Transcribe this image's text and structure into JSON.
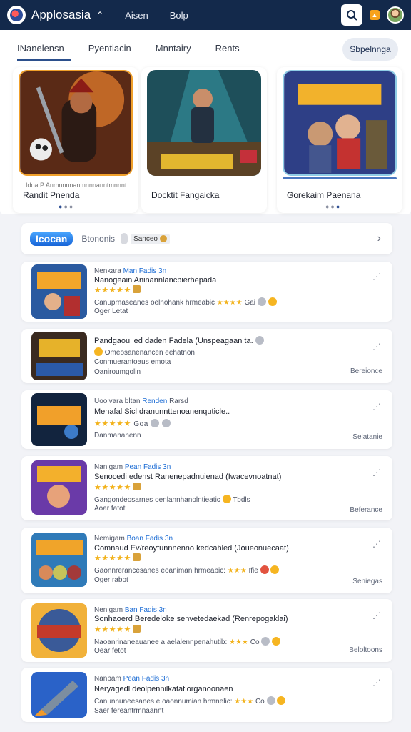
{
  "header": {
    "title": "Applosasia",
    "caret": "^",
    "nav": [
      "Aisen",
      "Bolp"
    ]
  },
  "tabs": [
    "INanelensn",
    "Pyentiacin",
    "Mnntairy",
    "Rents"
  ],
  "see_all": "Sbpelnnga",
  "featured": [
    {
      "sub": "Idoa P Anmnnnnanmnnnanntmnnnt",
      "name": "Randit Pnenda"
    },
    {
      "sub": "",
      "name": "Docktit Fangaicka"
    },
    {
      "sub": "",
      "name": "Gorekaim Paenana"
    }
  ],
  "filter": {
    "brand": "Icocan",
    "label": "Btononis",
    "tag": "Sanceo"
  },
  "list": [
    {
      "t1a": "Nenkara ",
      "t1b": "Man Fadis 3n",
      "t2": "Nanogeain Aninannlancpierhepada",
      "t3": "★★★★★",
      "t4": "Canuprnaseanes oelnohank hrmeabic",
      "t4b": "Gai",
      "t5": "Oger Letat",
      "side": ""
    },
    {
      "t1a": "",
      "t1b": "",
      "t2": "Pandgaou led daden Fadela (Unspeagaan ta.",
      "t3": "Omeosanenancen eehatnon",
      "t4": "Conmuerantoaus emota",
      "t4b": "",
      "t5": "Oaniroumgolin",
      "side": "Bereionce"
    },
    {
      "t1a": "Uoolvara bltan ",
      "t1b": "Renden",
      "t1c": " Rarsd",
      "t2": "Menafal Sicl dranunnttenoanenquticle..",
      "t3": "★★★★★",
      "t4": "Goa",
      "t4b": "",
      "t5": "Danmananenn",
      "side": "Selatanie"
    },
    {
      "t1a": "Nanlgam ",
      "t1b": "Pean Fadis 3n",
      "t2": "Senocedi edenst Ranenepadnuienad (Iwacevnoatnat)",
      "t3": "★★★★★",
      "t4": "Gangondeosarnes oenlannhanolntieatic",
      "t4b": "Tbdls",
      "t5": "Aoar fatot",
      "side": "Beferance"
    },
    {
      "t1a": "Nemigam ",
      "t1b": "Boan Fadis 3n",
      "t2": "Comnaud Ev/reoyfunnnenno kedcahled (Joueonuecaat)",
      "t3": "★★★★★",
      "t4": "Gaonnrerancesanes eoaniman hrmeabic:",
      "t4b": "Ifie",
      "t5": "Oger rabot",
      "side": "Seniegas"
    },
    {
      "t1a": "Nenigam ",
      "t1b": "Ban Fadis 3n",
      "t2": "Sonhaoerd Beredeloke senvetedaekad (Renrepogaklai)",
      "t3": "★★★★★",
      "t4": "Naoanrinaneauanee a aelalennpenahutib:",
      "t4b": "Co",
      "t5": "Oear fetot",
      "side": "Beloltoons"
    },
    {
      "t1a": "Nanpam ",
      "t1b": "Pean Fadis 3n",
      "t2": "Neryagedl deolpennilkatatiorganoonaen",
      "t3": "",
      "t4": "Canunnuneesanes e oaonnumian hrmnelic:",
      "t4b": "Co",
      "t5": "Saer fereantrmnaannt",
      "side": ""
    }
  ]
}
